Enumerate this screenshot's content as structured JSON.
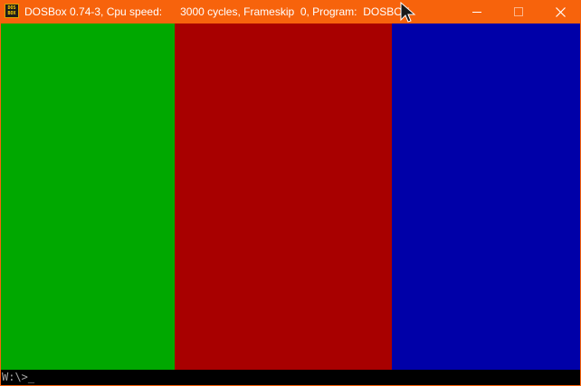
{
  "window": {
    "title": {
      "app": "DOSBox 0.74-3, Cpu speed:",
      "cycles": "3000 cycles, Frameskip  0, Program:",
      "program": "DOSBOX"
    },
    "app_icon": {
      "line1": "DOS",
      "line2": "BOX"
    },
    "controls": [
      "minimize-icon",
      "maximize-icon",
      "close-icon"
    ]
  },
  "screen": {
    "bars": [
      {
        "name": "green",
        "color": "#00a800"
      },
      {
        "name": "red",
        "color": "#a80000"
      },
      {
        "name": "blue",
        "color": "#0000a8"
      }
    ],
    "prompt": "W:\\>",
    "cursor": "_"
  },
  "colors": {
    "titlebar": "#f7630c",
    "prompt_text": "#a8a8a8"
  }
}
